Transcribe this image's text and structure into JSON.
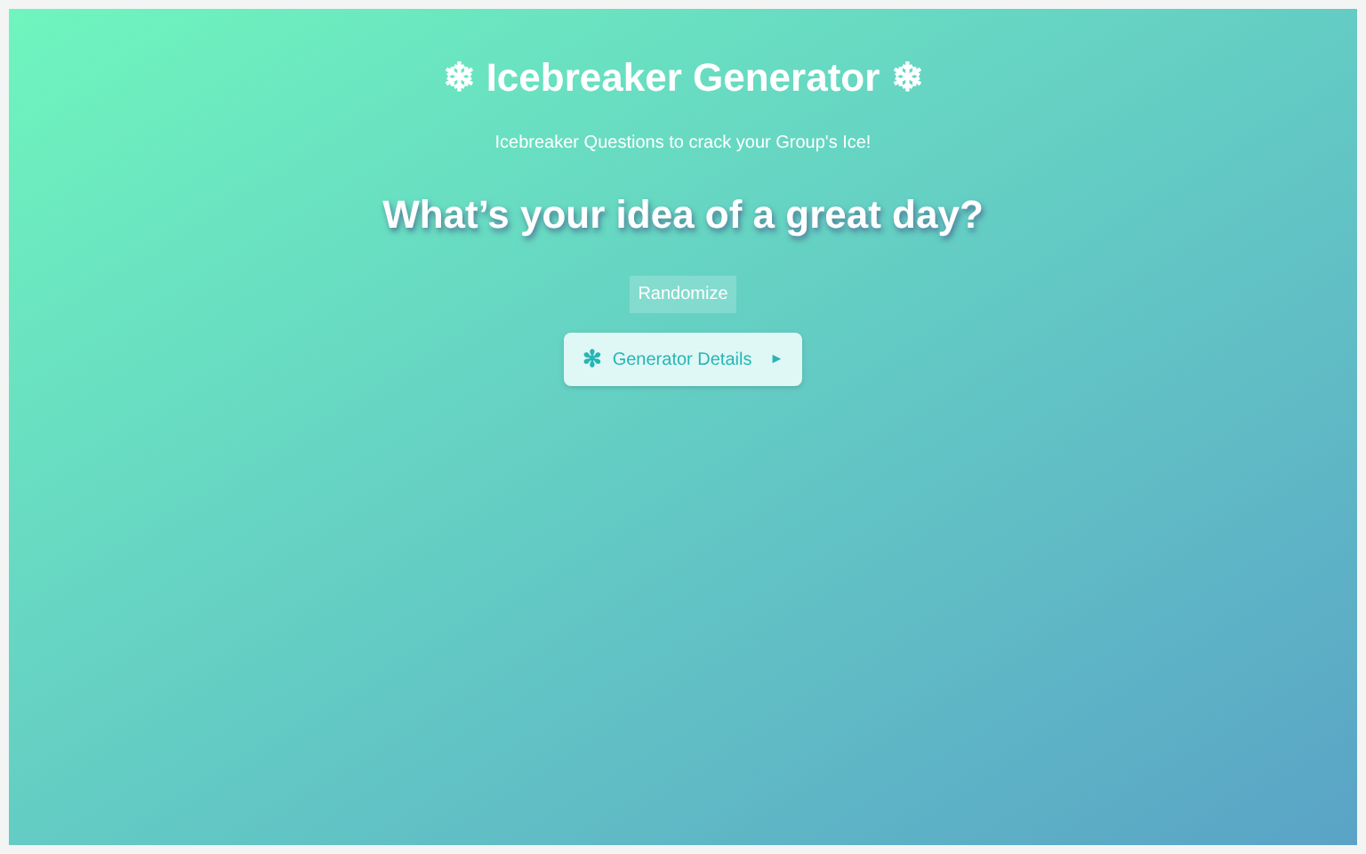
{
  "title": "❄ Icebreaker Generator ❄",
  "subtitle": "Icebreaker Questions to crack your Group's Ice!",
  "question": "What’s your idea of a great day?",
  "randomize_button": "Randomize",
  "details": {
    "icon": "✻",
    "label": "Generator Details",
    "marker": "►",
    "expanded": false
  }
}
